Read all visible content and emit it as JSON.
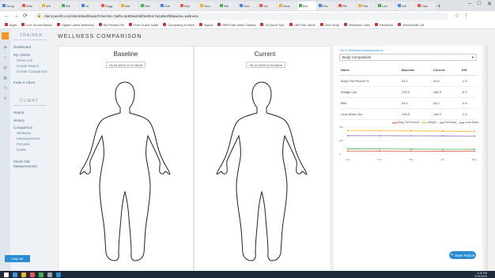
{
  "browser": {
    "tabs": [
      "Goog",
      "Whe",
      "Wh",
      "Wh",
      "Ju",
      "Sugg",
      "Nut",
      "Rec",
      "Guit",
      "Key",
      "Goo",
      "Ste",
      "Goo",
      "Ulc",
      "Ama",
      "Bra",
      "Eric",
      "Fitr",
      "Pea",
      "Loo",
      "Vid",
      "Calc"
    ],
    "active_tab_index": 15,
    "url": "client.peerfit.com/client/dashboard?clientId=7a8f1c4e9b5a2d6f3e0b4c7a1d8e2f6b&view=wellness",
    "bookmarks": [
      "Apps",
      "Live Sound Basics",
      "Sigma Lanes Wellness",
      "My Fitness Pal",
      "Free Guitar Scale",
      "Computing in Kitch",
      "Sigma",
      "PBS Kids Video Games",
      "25 Quick Tips",
      "Lift! Prac Sams",
      "Dice Shop",
      "Wellness Links",
      "Facebook",
      "Wheelchair Lift"
    ]
  },
  "sidebar": {
    "section_trainer": "TRAINER",
    "items_trainer": [
      "Dashboard",
      "My Clients",
      "Client List",
      "Create Report",
      "Create Comparison",
      "Invite a Client"
    ],
    "section_client": "CLIENT",
    "items_client": [
      "Report",
      "History",
      "Comparison",
      "Wellness",
      "Measurements",
      "Pictures",
      "Goals",
      "Client Add Measurements"
    ],
    "logout": "Log out"
  },
  "main": {
    "title": "WELLNESS COMPARISON",
    "baseline": {
      "label": "Baseline",
      "date": "01-04-2020 11:22 AM ▾"
    },
    "current": {
      "label": "Current",
      "date": "05-15-2020 11:03 AM ▾"
    }
  },
  "panel": {
    "link": "Go to Wellness Measurements",
    "select_value": "Body Composition",
    "table": {
      "headers": [
        "Name",
        "Baseline",
        "Current",
        "Diff"
      ],
      "rows": [
        [
          "Body Fat Percent %",
          "22.1",
          "20.6",
          "-1.5"
        ],
        [
          "Weight Lbs",
          "175.0",
          "168.8",
          "-6.2"
        ],
        [
          "BMI",
          "25.1",
          "24.2",
          "-0.9"
        ],
        [
          "Lean Mass Lbs",
          "136.3",
          "134.0",
          "-2.3"
        ]
      ]
    },
    "save_button": "Save Report"
  },
  "chart_data": {
    "type": "line",
    "x": [
      "Jan",
      "Feb",
      "Mar",
      "Apr",
      "May"
    ],
    "series": [
      {
        "name": "Body Fat Percent",
        "values": [
          22.1,
          21.6,
          21.2,
          20.9,
          20.6
        ],
        "color": "#e25b4f"
      },
      {
        "name": "Weight",
        "values": [
          175.0,
          173.5,
          171.8,
          170.2,
          168.8
        ],
        "color": "#f2b134"
      },
      {
        "name": "Fat Mass",
        "values": [
          38.7,
          37.6,
          36.4,
          35.4,
          34.8
        ],
        "color": "#4caf50"
      },
      {
        "name": "Lean Mass",
        "values": [
          136.3,
          135.9,
          135.4,
          134.8,
          134.0
        ],
        "color": "#8e6bbf"
      }
    ],
    "ylim": [
      0,
      200
    ],
    "ytick_labels": [
      "200",
      "100",
      "0"
    ]
  },
  "taskbar": {
    "time": "1:38 PM",
    "date": "5/15/2020"
  },
  "icons": [
    "back-icon",
    "forward-icon",
    "reload-icon",
    "lock-icon",
    "star-icon",
    "menu-icon",
    "person-icon",
    "search-icon",
    "chart-icon",
    "settings-icon"
  ]
}
